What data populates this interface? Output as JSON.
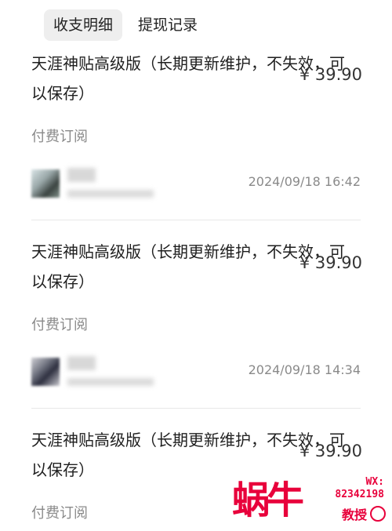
{
  "tabs": [
    {
      "label": "收支明细",
      "active": true
    },
    {
      "label": "提现记录",
      "active": false
    }
  ],
  "records": [
    {
      "title_line1": "天涯神贴高级版（长期更新维护，不失效，可",
      "title_line2": "以保存）",
      "price": "¥ 39.90",
      "type": "付费订阅",
      "time": "2024/09/18 16:42"
    },
    {
      "title_line1": "天涯神贴高级版（长期更新维护，不失效，可",
      "title_line2": "以保存）",
      "price": "¥ 39.90",
      "type": "付费订阅",
      "time": "2024/09/18 14:34"
    },
    {
      "title_line1": "天涯神贴高级版（长期更新维护，不失效，可",
      "title_line2": "以保存）",
      "price": "¥ 39.90",
      "type": "付费订阅",
      "time": ""
    }
  ],
  "watermark": {
    "brand": "蜗牛",
    "contact_label": "WX:",
    "contact_value": "82342198",
    "sub": "教授"
  },
  "colors": {
    "accent": "#e8003b",
    "muted": "#8a8a8a",
    "tab_active_bg": "#eeeeee"
  }
}
